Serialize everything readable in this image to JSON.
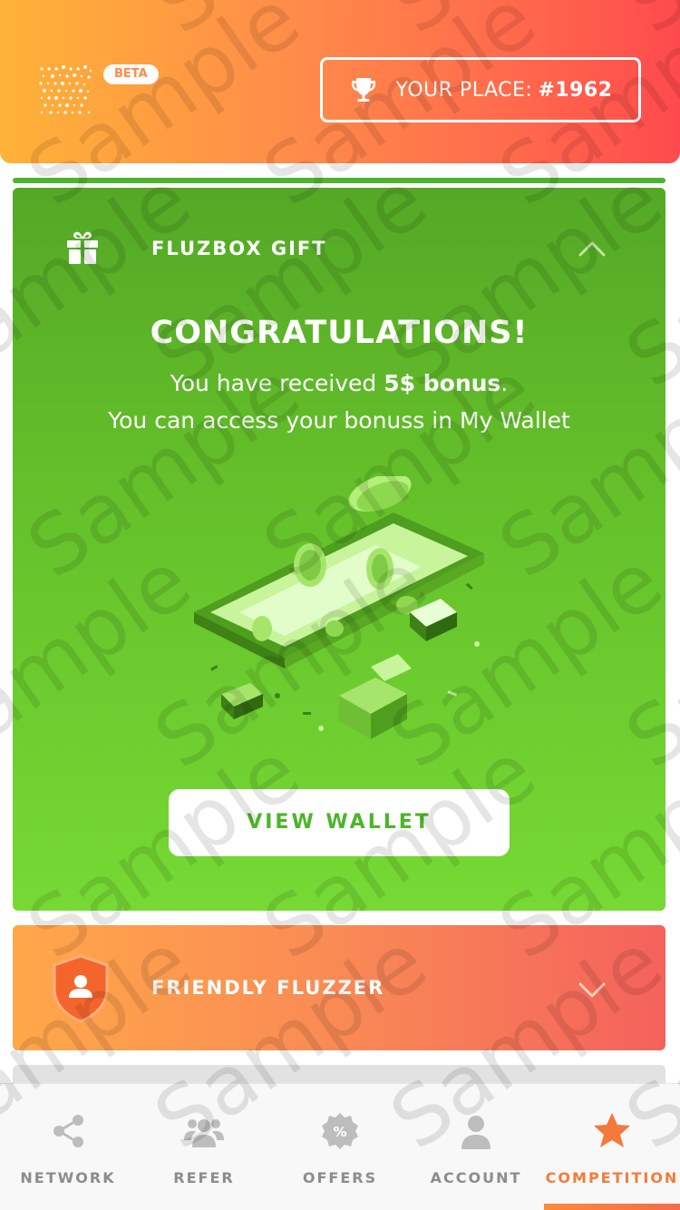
{
  "header": {
    "beta_label": "BETA",
    "place_label": "YOUR PLACE:",
    "place_value": "#1962"
  },
  "progress": {
    "fraction": 1.0
  },
  "gift_card": {
    "title": "FLUZBOX GIFT",
    "heading": "CONGRATULATIONS!",
    "line1_prefix": "You have received ",
    "line1_bold": "5$ bonus",
    "line1_suffix": ".",
    "line2": "You can access your bonuss in My Wallet",
    "button_label": "VIEW WALLET"
  },
  "friendly_card": {
    "title": "FRIENDLY FLUZZER"
  },
  "nav": {
    "items": [
      {
        "label": "NETWORK",
        "icon": "network-icon"
      },
      {
        "label": "REFER",
        "icon": "group-icon"
      },
      {
        "label": "OFFERS",
        "icon": "percent-badge-icon"
      },
      {
        "label": "ACCOUNT",
        "icon": "person-icon"
      },
      {
        "label": "COMPETITION",
        "icon": "star-icon"
      }
    ],
    "active": "COMPETITION"
  },
  "watermark_text": "Sample",
  "colors": {
    "green": "#4cb52a",
    "orange_accent": "#f47c38",
    "inactive_nav": "#8c8c8c"
  }
}
